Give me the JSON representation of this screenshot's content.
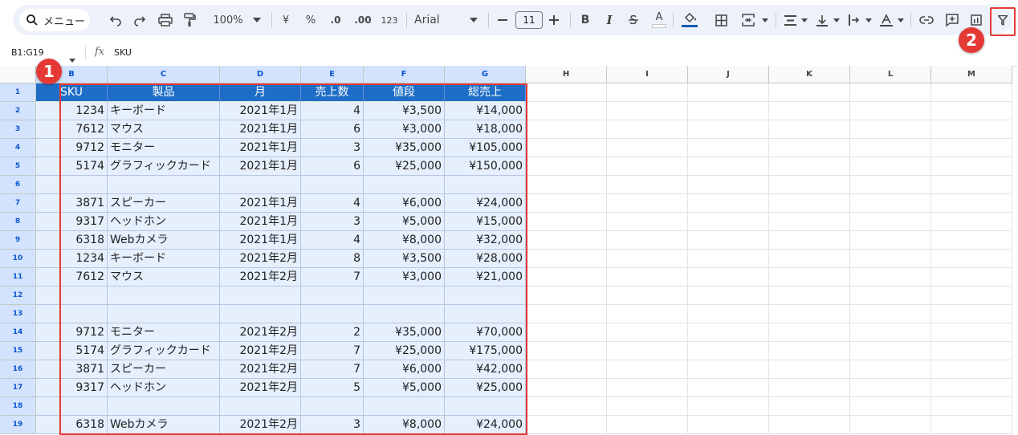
{
  "toolbar": {
    "menu_label": "メニュー",
    "zoom": "100%",
    "currency": "¥",
    "percent": "%",
    "dec_decrease": ".0",
    "dec_increase": ".00",
    "number_format": "123",
    "font": "Arial",
    "font_size": "11",
    "bold": "B",
    "italic": "I",
    "text_color": "A"
  },
  "formula_bar": {
    "name_box": "B1:G19",
    "fx": "fx",
    "content": "SKU"
  },
  "columns": [
    "B",
    "C",
    "D",
    "E",
    "F",
    "G",
    "H",
    "I",
    "J",
    "K",
    "L",
    "M"
  ],
  "rows": [
    "1",
    "2",
    "3",
    "4",
    "5",
    "6",
    "7",
    "8",
    "9",
    "10",
    "11",
    "12",
    "13",
    "14",
    "15",
    "16",
    "17",
    "18",
    "19"
  ],
  "table": {
    "headers": [
      "SKU",
      "製品",
      "月",
      "売上数",
      "値段",
      "総売上"
    ],
    "rows": [
      [
        "1234",
        "キーボード",
        "2021年1月",
        "4",
        "¥3,500",
        "¥14,000"
      ],
      [
        "7612",
        "マウス",
        "2021年1月",
        "6",
        "¥3,000",
        "¥18,000"
      ],
      [
        "9712",
        "モニター",
        "2021年1月",
        "3",
        "¥35,000",
        "¥105,000"
      ],
      [
        "5174",
        "グラフィックカード",
        "2021年1月",
        "6",
        "¥25,000",
        "¥150,000"
      ],
      [
        "",
        "",
        "",
        "",
        "",
        ""
      ],
      [
        "3871",
        "スピーカー",
        "2021年1月",
        "4",
        "¥6,000",
        "¥24,000"
      ],
      [
        "9317",
        "ヘッドホン",
        "2021年1月",
        "3",
        "¥5,000",
        "¥15,000"
      ],
      [
        "6318",
        "Webカメラ",
        "2021年1月",
        "4",
        "¥8,000",
        "¥32,000"
      ],
      [
        "1234",
        "キーボード",
        "2021年2月",
        "8",
        "¥3,500",
        "¥28,000"
      ],
      [
        "7612",
        "マウス",
        "2021年2月",
        "7",
        "¥3,000",
        "¥21,000"
      ],
      [
        "",
        "",
        "",
        "",
        "",
        ""
      ],
      [
        "",
        "",
        "",
        "",
        "",
        ""
      ],
      [
        "9712",
        "モニター",
        "2021年2月",
        "2",
        "¥35,000",
        "¥70,000"
      ],
      [
        "5174",
        "グラフィックカード",
        "2021年2月",
        "7",
        "¥25,000",
        "¥175,000"
      ],
      [
        "3871",
        "スピーカー",
        "2021年2月",
        "7",
        "¥6,000",
        "¥42,000"
      ],
      [
        "9317",
        "ヘッドホン",
        "2021年2月",
        "5",
        "¥5,000",
        "¥25,000"
      ],
      [
        "",
        "",
        "",
        "",
        "",
        ""
      ],
      [
        "6318",
        "Webカメラ",
        "2021年2月",
        "3",
        "¥8,000",
        "¥24,000"
      ]
    ]
  },
  "annotations": {
    "badge1": "1",
    "badge2": "2",
    "color": "#e53935"
  },
  "colors": {
    "header_bg": "#1e6ec8",
    "selection_bg": "#e6effc",
    "toolbar_bg": "#edf2fa"
  }
}
